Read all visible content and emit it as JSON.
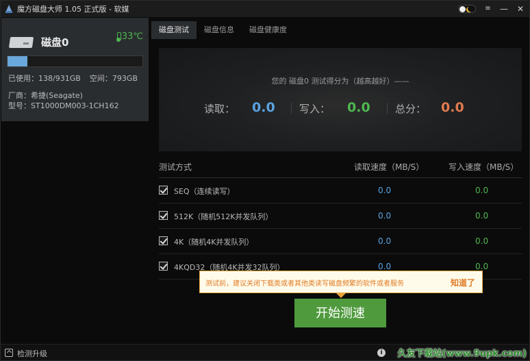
{
  "app": {
    "title": "魔方磁盘大师 1.05 正式版 - 软媒"
  },
  "window_controls": {
    "menu": "≡",
    "minimize": "—",
    "close": "✕"
  },
  "disk": {
    "name": "磁盘0",
    "temperature": "33℃",
    "usage_fraction": 0.148,
    "used": "已使用：138/931GB",
    "free": "空间：793GB",
    "vendor": "厂商：希捷(Seagate)",
    "model": "型号：ST1000DM003-1CH162"
  },
  "tabs": [
    {
      "label": "磁盘测试",
      "active": true
    },
    {
      "label": "磁盘信息",
      "active": false
    },
    {
      "label": "磁盘健康度",
      "active": false
    }
  ],
  "score": {
    "caption": "您的 磁盘0 测试得分为（越高越好）——",
    "read_label": "读取：",
    "read_value": "0.0",
    "write_label": "写入：",
    "write_value": "0.0",
    "total_label": "总分：",
    "total_value": "0.0"
  },
  "table": {
    "headers": {
      "method": "测试方式",
      "read": "读取速度（MB/S）",
      "write": "写入速度（MB/S）"
    },
    "rows": [
      {
        "method": "SEQ（连续读写）",
        "read": "0.0",
        "write": "0.0",
        "checked": true
      },
      {
        "method": "512K（随机512K并发队列）",
        "read": "0.0",
        "write": "0.0",
        "checked": true
      },
      {
        "method": "4K（随机4K并发队列）",
        "read": "0.0",
        "write": "0.0",
        "checked": true
      },
      {
        "method": "4KQD32（随机4K并发32队列）",
        "read": "0.0",
        "write": "0.0",
        "checked": true
      }
    ]
  },
  "tooltip": {
    "text": "测试前，建议关闭下载类或者其他类读写磁盘频繁的软件或者服务",
    "dismiss": "知道了"
  },
  "start_button": {
    "label": "开始测速"
  },
  "statusbar": {
    "upgrade": "检测升级",
    "info_icon": "i",
    "watermark": "久友下载站(www.9upk.com)"
  },
  "colors": {
    "accent_green": "#4f9a3d",
    "read_blue": "#5aa3e0",
    "write_green": "#4fb84f",
    "total_orange": "#e07a4f"
  }
}
